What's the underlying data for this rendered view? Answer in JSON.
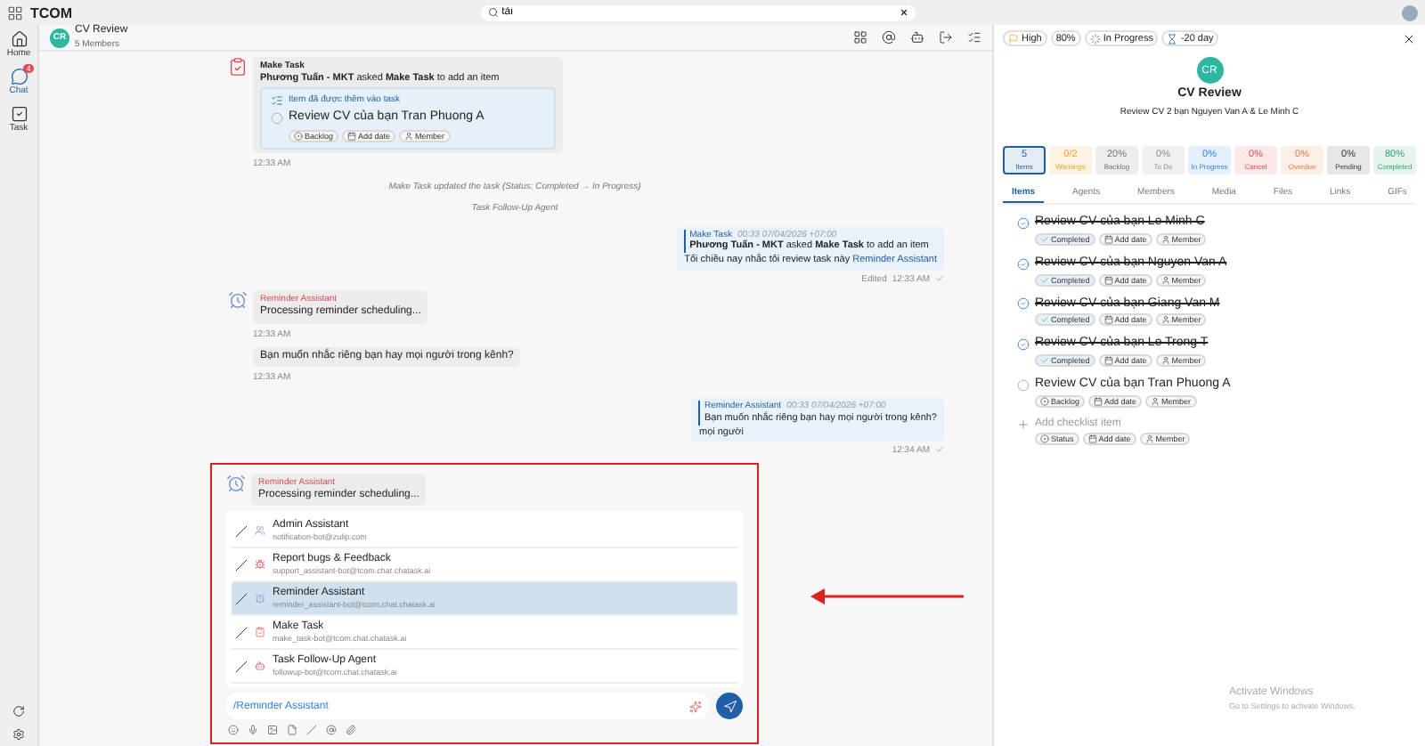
{
  "app": {
    "name": "TCOM"
  },
  "search": {
    "value": "tải"
  },
  "nav": [
    {
      "kind": "home",
      "label": "Home",
      "selected": false
    },
    {
      "kind": "chat",
      "label": "Chat",
      "selected": true,
      "badge": "4"
    },
    {
      "kind": "task",
      "label": "Task",
      "selected": false
    }
  ],
  "chat": {
    "avatar": "CR",
    "title": "CV Review",
    "subtitle": "5 Members"
  },
  "messages": [
    {
      "kind": "task_card",
      "sender": "Make Task",
      "text": "**Phương Tuấn - MKT** asked **Make Task** to add an item",
      "card_title": "Item đã được thêm vào task",
      "item": {
        "title": "Review CV của bạn Tran Phuong A",
        "checked": false,
        "tags": [
          "Backlog",
          "Add date",
          "Member"
        ]
      },
      "time": "12:33 AM"
    },
    {
      "kind": "system",
      "text": "Make Task updated the task (Status: Completed → In Progress)"
    },
    {
      "kind": "system",
      "text": "Task Follow-Up Agent"
    },
    {
      "kind": "reply",
      "quote_sender": "Make Task",
      "quote_time": "00:33 07/04/2026 +07:00",
      "quote_text": "**Phương Tuấn - MKT** asked **Make Task** to add an item",
      "text": "Tối chiều nay nhắc tôi review task này",
      "mention": "Reminder Assistant",
      "edited": "Edited",
      "time": "12:33 AM"
    },
    {
      "kind": "bot",
      "sender": "Reminder Assistant",
      "text": "Processing reminder scheduling...",
      "time": "12:33 AM"
    },
    {
      "kind": "plain",
      "text": "Bạn muốn nhắc riêng bạn hay mọi người trong kênh?",
      "time": "12:33 AM"
    },
    {
      "kind": "reply",
      "quote_sender": "Reminder Assistant",
      "quote_time": "00:33 07/04/2026 +07:00",
      "quote_text": "Bạn muốn nhắc riêng bạn hay mọi người trong kênh?",
      "text": "mọi người",
      "time": "12:34 AM"
    }
  ],
  "highlight": {
    "message": {
      "sender": "Reminder Assistant",
      "text": "Processing reminder scheduling..."
    },
    "mentions": [
      {
        "kind": "admin",
        "name": "Admin Assistant",
        "email": "notification-bot@zulip.com",
        "selected": false
      },
      {
        "kind": "bug",
        "name": "Report bugs & Feedback",
        "email": "support_assistant-bot@tcom.chat.chatask.ai",
        "selected": false
      },
      {
        "kind": "reminder",
        "name": "Reminder Assistant",
        "email": "reminder_assistant-bot@tcom.chat.chatask.ai",
        "selected": true
      },
      {
        "kind": "task",
        "name": "Make Task",
        "email": "make_task-bot@tcom.chat.chatask.ai",
        "selected": false
      },
      {
        "kind": "followup",
        "name": "Task Follow-Up Agent",
        "email": "followup-bot@tcom.chat.chatask.ai",
        "selected": false
      }
    ],
    "composer": {
      "value": "/Reminder Assistant"
    }
  },
  "task": {
    "chips": [
      {
        "kind": "priority",
        "label": "High"
      },
      {
        "kind": "percent",
        "label": "80%"
      },
      {
        "kind": "status",
        "label": "In Progress"
      },
      {
        "kind": "due",
        "label": "-20 day"
      }
    ],
    "avatar": "CR",
    "title": "CV Review",
    "description": "Review CV 2 bạn Nguyen Van A & Le Minh C",
    "stats": [
      {
        "kind": "items",
        "value": "5",
        "label": "Items",
        "selected": true
      },
      {
        "kind": "warnings",
        "value": "0/2",
        "label": "Warnings",
        "selected": false
      },
      {
        "kind": "backlog",
        "value": "20%",
        "label": "Backlog",
        "selected": false
      },
      {
        "kind": "todo",
        "value": "0%",
        "label": "To Do",
        "selected": false
      },
      {
        "kind": "progress",
        "value": "0%",
        "label": "In Progress",
        "selected": false
      },
      {
        "kind": "cancel",
        "value": "0%",
        "label": "Cancel",
        "selected": false
      },
      {
        "kind": "overdue",
        "value": "0%",
        "label": "Overdue",
        "selected": false
      },
      {
        "kind": "pending",
        "value": "0%",
        "label": "Pending",
        "selected": false
      },
      {
        "kind": "completed",
        "value": "80%",
        "label": "Completed",
        "selected": false
      }
    ],
    "tabs": [
      {
        "label": "Items",
        "selected": true
      },
      {
        "label": "Agents",
        "selected": false
      },
      {
        "label": "Members",
        "selected": false
      },
      {
        "label": "Media",
        "selected": false
      },
      {
        "label": "Files",
        "selected": false
      },
      {
        "label": "Links",
        "selected": false
      },
      {
        "label": "GIFs",
        "selected": false
      }
    ],
    "items": [
      {
        "title": "Review CV của bạn Le Minh C",
        "checked": true,
        "tags": [
          "Completed",
          "Add date",
          "Member"
        ]
      },
      {
        "title": "Review CV của bạn Nguyen Van A",
        "checked": true,
        "tags": [
          "Completed",
          "Add date",
          "Member"
        ]
      },
      {
        "title": "Review CV của bạn Giang Van M",
        "checked": true,
        "tags": [
          "Completed",
          "Add date",
          "Member"
        ]
      },
      {
        "title": "Review CV của bạn Le Trong T",
        "checked": true,
        "tags": [
          "Completed",
          "Add date",
          "Member"
        ]
      },
      {
        "title": "Review CV của bạn Tran Phuong A",
        "checked": false,
        "tags": [
          "Backlog",
          "Add date",
          "Member"
        ]
      }
    ],
    "add_item": {
      "placeholder": "Add checklist item",
      "tags": [
        "Status",
        "Add date",
        "Member"
      ]
    }
  },
  "os_notice": {
    "title": "Activate Windows",
    "text": "Go to Settings to activate Windows."
  }
}
